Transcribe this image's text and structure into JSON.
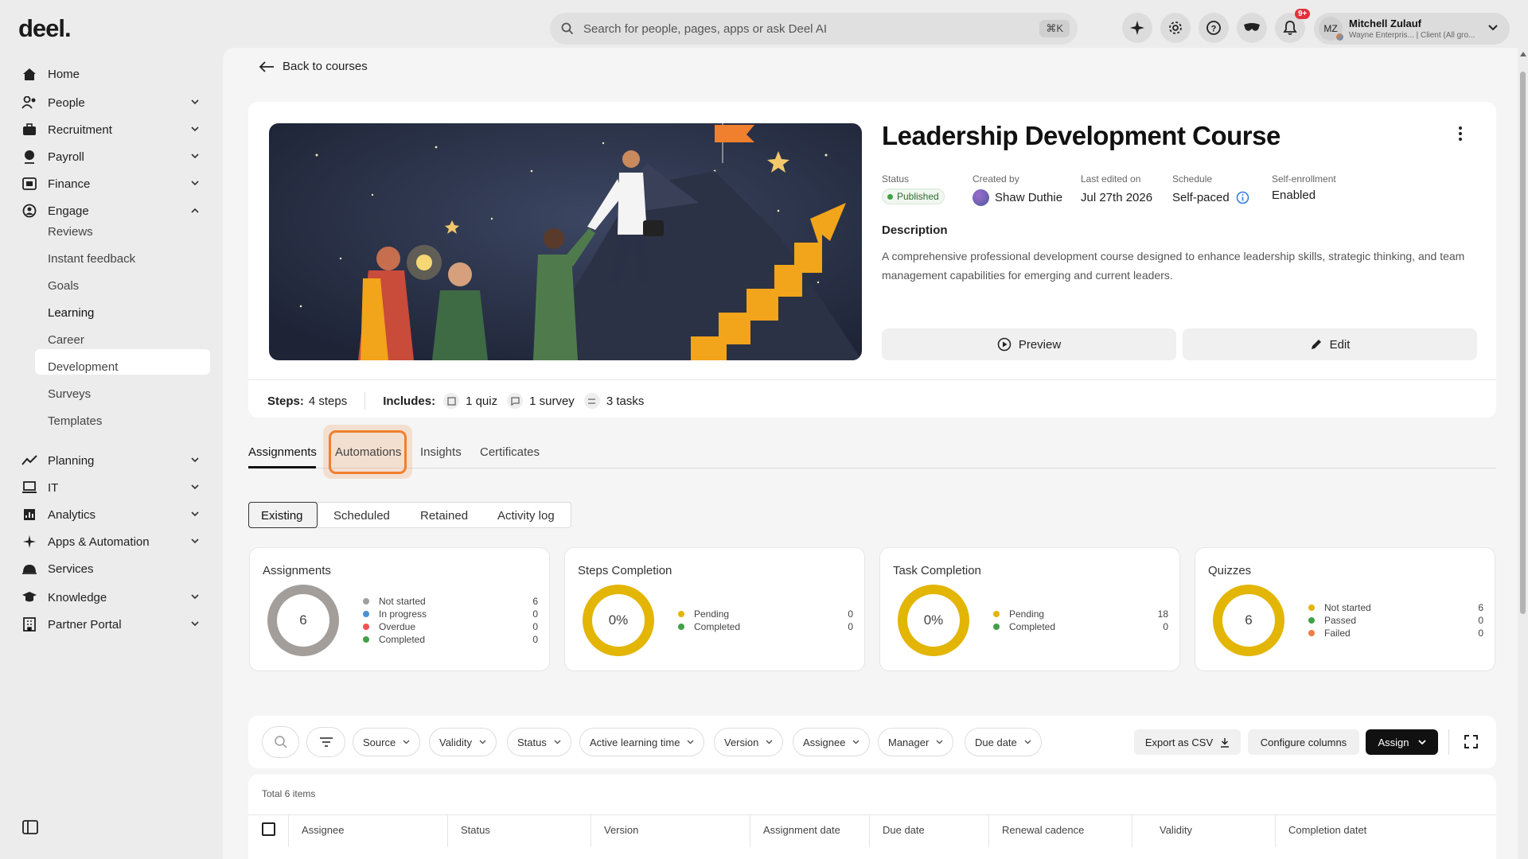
{
  "brand": {
    "logo": "deel.",
    "accent": "#f07f2e"
  },
  "search": {
    "placeholder": "Search for people, pages, apps or ask Deel AI",
    "shortcut": "⌘K"
  },
  "notifications": {
    "count": "9+"
  },
  "user": {
    "initials": "MZ",
    "name": "Mitchell Zulauf",
    "subtitle": "Wayne Enterpris... | Client (All gro..."
  },
  "sidebar": {
    "items": [
      {
        "label": "Home",
        "icon": "home-icon"
      },
      {
        "label": "People",
        "icon": "people-icon"
      },
      {
        "label": "Recruitment",
        "icon": "briefcase-icon"
      },
      {
        "label": "Payroll",
        "icon": "payroll-icon"
      },
      {
        "label": "Finance",
        "icon": "finance-icon"
      },
      {
        "label": "Engage",
        "icon": "engage-icon"
      },
      {
        "label": "Planning",
        "icon": "trend-icon"
      },
      {
        "label": "IT",
        "icon": "laptop-icon"
      },
      {
        "label": "Analytics",
        "icon": "analytics-icon"
      },
      {
        "label": "Apps & Automation",
        "icon": "sparkle-icon"
      },
      {
        "label": "Services",
        "icon": "bell-icon"
      },
      {
        "label": "Knowledge",
        "icon": "graduation-icon"
      },
      {
        "label": "Partner Portal",
        "icon": "building-icon"
      }
    ],
    "engage_sub": [
      "Reviews",
      "Instant feedback",
      "Goals",
      "Learning",
      "Career",
      "Development",
      "Surveys",
      "Templates"
    ]
  },
  "back": {
    "label": "Back to courses"
  },
  "course": {
    "title": "Leadership Development Course",
    "status_label": "Status",
    "status": "Published",
    "created_label": "Created by",
    "creator": "Shaw Duthie",
    "edited_label": "Last edited on",
    "edited": "Jul 27th 2026",
    "schedule_label": "Schedule",
    "schedule": "Self-paced",
    "enroll_label": "Self-enrollment",
    "enroll": "Enabled",
    "desc_label": "Description",
    "description": "A comprehensive professional development course designed to enhance leadership skills, strategic thinking, and team management capabilities for emerging and current leaders.",
    "preview": "Preview",
    "edit": "Edit",
    "steps_label": "Steps:",
    "steps": "4 steps",
    "includes_label": "Includes:",
    "quiz": "1 quiz",
    "survey": "1 survey",
    "tasks": "3 tasks"
  },
  "tabs": [
    "Assignments",
    "Automations",
    "Insights",
    "Certificates"
  ],
  "subtabs": [
    "Existing",
    "Scheduled",
    "Retained",
    "Activity log"
  ],
  "stats": [
    {
      "title": "Assignments",
      "center": "6",
      "color": "#a39e9a",
      "rows": [
        {
          "label": "Not started",
          "value": "6",
          "color": "#a39e9a"
        },
        {
          "label": "In progress",
          "value": "0",
          "color": "#4a90d9"
        },
        {
          "label": "Overdue",
          "value": "0",
          "color": "#ef5350"
        },
        {
          "label": "Completed",
          "value": "0",
          "color": "#43a047"
        }
      ]
    },
    {
      "title": "Steps Completion",
      "center": "0%",
      "color": "#e3b505",
      "rows": [
        {
          "label": "Pending",
          "value": "0",
          "color": "#e3b505"
        },
        {
          "label": "Completed",
          "value": "0",
          "color": "#43a047"
        }
      ]
    },
    {
      "title": "Task Completion",
      "center": "0%",
      "color": "#e3b505",
      "rows": [
        {
          "label": "Pending",
          "value": "18",
          "color": "#e3b505"
        },
        {
          "label": "Completed",
          "value": "0",
          "color": "#43a047"
        }
      ]
    },
    {
      "title": "Quizzes",
      "center": "6",
      "color": "#e3b505",
      "rows": [
        {
          "label": "Not started",
          "value": "6",
          "color": "#e3b505"
        },
        {
          "label": "Passed",
          "value": "0",
          "color": "#43a047"
        },
        {
          "label": "Failed",
          "value": "0",
          "color": "#ef7b45"
        }
      ]
    }
  ],
  "filters": [
    "Source",
    "Validity",
    "Status",
    "Active learning time",
    "Version",
    "Assignee",
    "Manager",
    "Due date"
  ],
  "actions": {
    "export": "Export as CSV",
    "configure": "Configure columns",
    "assign": "Assign"
  },
  "table": {
    "total": "Total 6 items",
    "columns": [
      "Assignee",
      "Status",
      "Version",
      "Assignment date",
      "Due date",
      "Renewal cadence",
      "Validity",
      "Completion datet"
    ]
  }
}
